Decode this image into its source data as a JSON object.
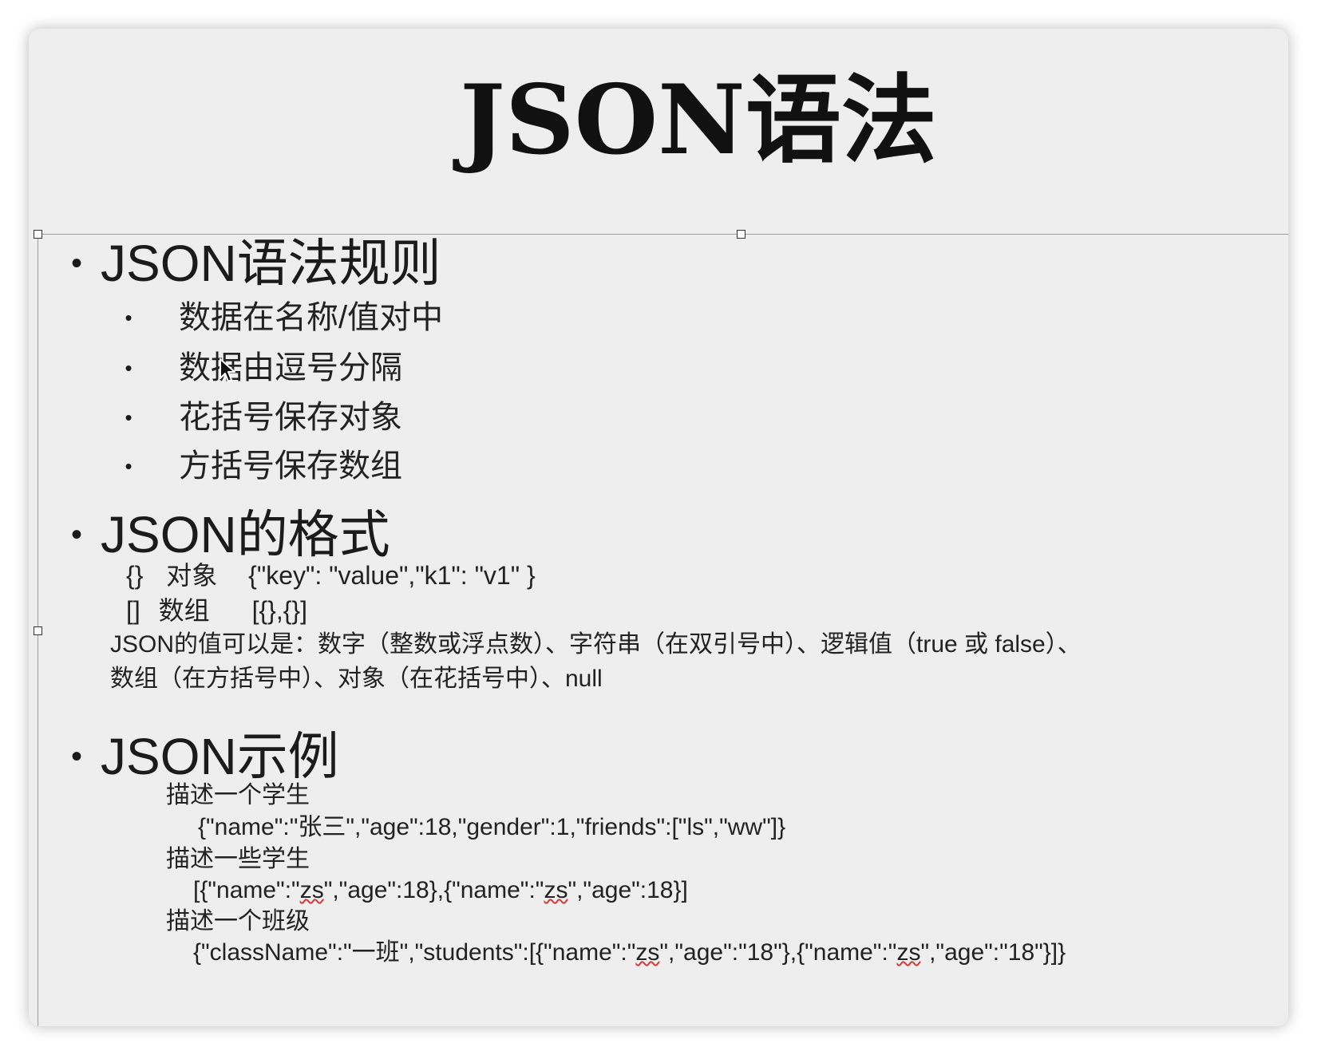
{
  "title": "JSON语法",
  "sections": [
    {
      "heading": "JSON语法规则",
      "rules": [
        "数据在名称/值对中",
        "数据由逗号分隔",
        "花括号保存对象",
        "方括号保存数组"
      ]
    },
    {
      "heading": "JSON的格式",
      "formats": [
        {
          "symbol": "{}",
          "name": "对象",
          "example": "{\"key\": \"value\",\"k1\": \"v1\" }"
        },
        {
          "symbol": "[]",
          "name": "数组",
          "example": "[{},{}]"
        }
      ],
      "values_line1": "JSON的值可以是：数字（整数或浮点数）、字符串（在双引号中）、逻辑值（true 或 false）、",
      "values_line2": "数组（在方括号中）、对象（在花括号中）、null"
    },
    {
      "heading": "JSON示例",
      "examples": [
        {
          "label": "描述一个学生",
          "code": "{\"name\":\"张三\",\"age\":18,\"gender\":1,\"friends\":[\"ls\",\"ww\"]}"
        },
        {
          "label": "描述一些学生",
          "code_parts": [
            "[{\"name\":\"",
            "zs",
            "\",\"age\":18},{\"name\":\"",
            "zs",
            "\",\"age\":18}]"
          ]
        },
        {
          "label": "描述一个班级",
          "code_parts": [
            "{\"className\":\"一班\",\"students\":[{\"name\":\"",
            "zs",
            "\",\"age\":\"18\"},{\"name\":\"",
            "zs",
            "\",\"age\":\"18\"}]}"
          ]
        }
      ]
    }
  ],
  "bullet_glyph": "•",
  "colors": {
    "background": "#eeeeee",
    "selection_frame": "#8a9bd6",
    "spellcheck": "#d23a3a"
  }
}
